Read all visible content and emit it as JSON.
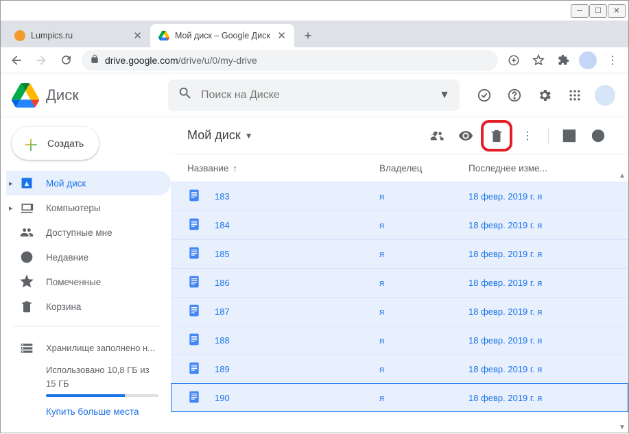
{
  "window": {
    "minimize": "─",
    "maximize": "☐",
    "close": "✕"
  },
  "tabs": [
    {
      "title": "Lumpics.ru",
      "active": false,
      "favicon_color": "#f29b2c"
    },
    {
      "title": "Мой диск – Google Диск",
      "active": true
    }
  ],
  "address": {
    "host": "drive.google.com",
    "path": "/drive/u/0/my-drive"
  },
  "app": {
    "name": "Диск",
    "search_placeholder": "Поиск на Диске",
    "create": "Создать"
  },
  "sidebar": {
    "items": [
      {
        "id": "my-drive",
        "label": "Мой диск",
        "expandable": true,
        "active": true
      },
      {
        "id": "computers",
        "label": "Компьютеры",
        "expandable": true
      },
      {
        "id": "shared",
        "label": "Доступные мне"
      },
      {
        "id": "recent",
        "label": "Недавние"
      },
      {
        "id": "starred",
        "label": "Помеченные"
      },
      {
        "id": "trash",
        "label": "Корзина"
      }
    ],
    "storage_title": "Хранилище заполнено н...",
    "storage_used": "Использовано 10,8 ГБ из 15 ГБ",
    "storage_buy": "Купить больше места"
  },
  "breadcrumb": {
    "label": "Мой диск"
  },
  "columns": {
    "name": "Название",
    "owner": "Владелец",
    "modified": "Последнее изме..."
  },
  "rows": [
    {
      "name": "183",
      "owner": "я",
      "modified": "18 февр. 2019 г.",
      "by": "я"
    },
    {
      "name": "184",
      "owner": "я",
      "modified": "18 февр. 2019 г.",
      "by": "я"
    },
    {
      "name": "185",
      "owner": "я",
      "modified": "18 февр. 2019 г.",
      "by": "я"
    },
    {
      "name": "186",
      "owner": "я",
      "modified": "18 февр. 2019 г.",
      "by": "я"
    },
    {
      "name": "187",
      "owner": "я",
      "modified": "18 февр. 2019 г.",
      "by": "я"
    },
    {
      "name": "188",
      "owner": "я",
      "modified": "18 февр. 2019 г.",
      "by": "я"
    },
    {
      "name": "189",
      "owner": "я",
      "modified": "18 февр. 2019 г.",
      "by": "я"
    },
    {
      "name": "190",
      "owner": "я",
      "modified": "18 февр. 2019 г.",
      "by": "я",
      "focused": true
    }
  ]
}
